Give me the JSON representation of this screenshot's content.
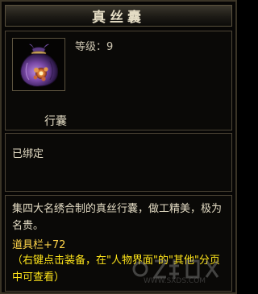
{
  "item": {
    "name": "真丝囊",
    "level": "等级：9",
    "type": "行囊",
    "bind_status": "已绑定",
    "description": "集四大名绣合制的真丝行囊，做工精美，极为名贵。",
    "bonus": "道具栏+72",
    "hint": "（右键点击装备，在\"人物界面\"的\"其他\"分页中可查看）",
    "icon": "silk-pouch-icon"
  },
  "watermark": {
    "text": "WWW.SXDS.COM",
    "logo": "sxds-logo"
  },
  "colors": {
    "title": "#e4dcc4",
    "text": "#e4dcc4",
    "bonus": "#ffd44a",
    "hint": "#ffe51a",
    "border": "#4e4636",
    "background": "#070605"
  }
}
